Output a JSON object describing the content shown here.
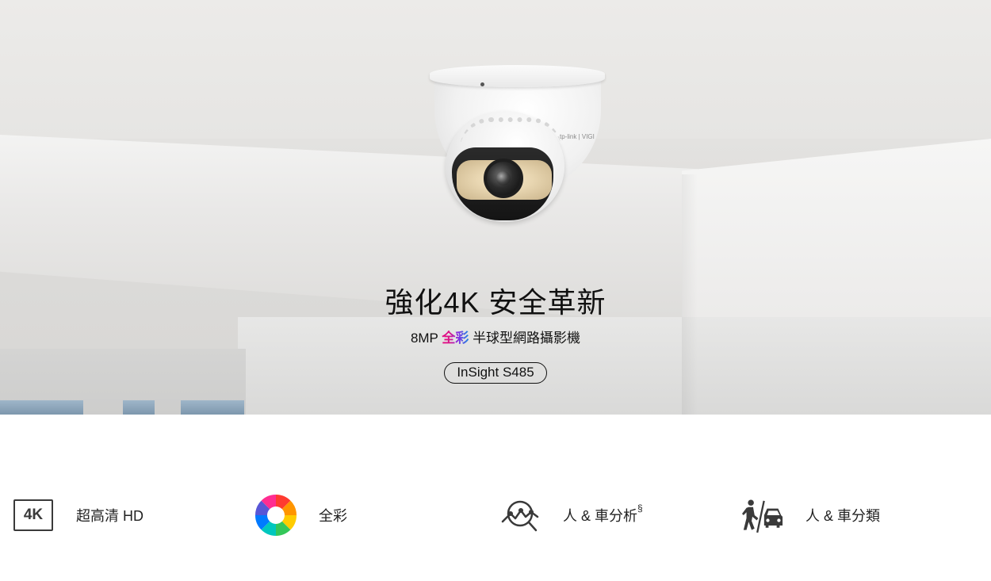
{
  "hero": {
    "title": "強化4K 安全革新",
    "subtitle_prefix": "8MP",
    "subtitle_color_word": "全彩",
    "subtitle_suffix": "半球型網路攝影機",
    "model": "InSight S485",
    "camera_brand_mark": "tp-link | VIGI"
  },
  "features": [
    {
      "icon": "4k-badge-icon",
      "icon_text": "4K",
      "label": "超高清 HD"
    },
    {
      "icon": "color-wheel-icon",
      "label": "全彩"
    },
    {
      "icon": "analytics-magnifier-icon",
      "label": "人 & 車分析",
      "superscript": "§"
    },
    {
      "icon": "person-vehicle-icon",
      "label": "人 & 車分類"
    }
  ],
  "colors": {
    "text": "#111111",
    "icon_gray": "#3a3a3a",
    "accent_magenta": "#e6007e",
    "accent_blue": "#1e88e5"
  }
}
